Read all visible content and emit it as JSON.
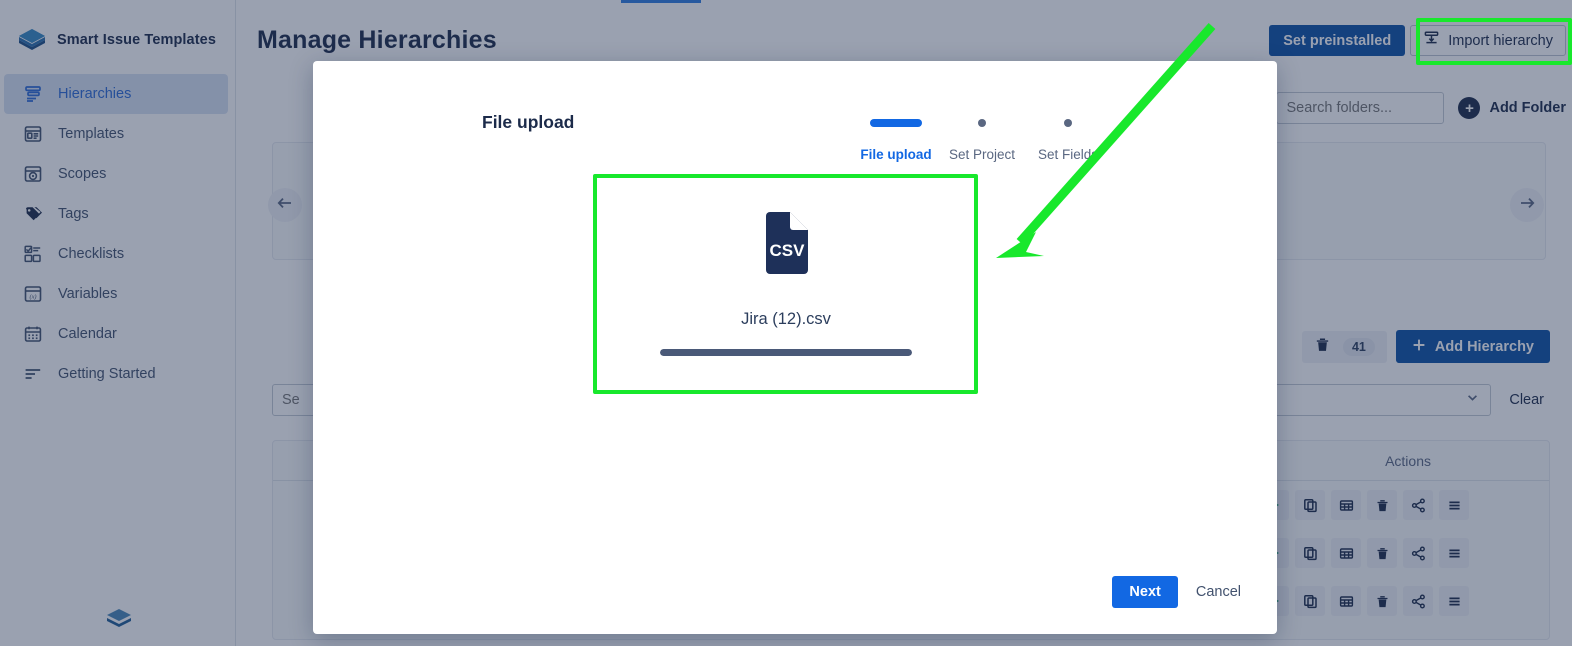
{
  "colors": {
    "brand_blue": "#0c50a4",
    "accent_blue": "#1268e3",
    "navy": "#1c2b4a",
    "annotation_green": "#18e82c",
    "play_green": "#1f9e6e",
    "progress_fill": "#4a5978"
  },
  "sidebar": {
    "brand": "Smart Issue Templates",
    "brand_logo_icon": "layers-stack-icon",
    "footer_logo_icon": "layers-stack-icon",
    "items": [
      {
        "label": "Hierarchies",
        "icon": "hierarchy-icon",
        "active": true
      },
      {
        "label": "Templates",
        "icon": "template-window-icon",
        "active": false
      },
      {
        "label": "Scopes",
        "icon": "scope-target-icon",
        "active": false
      },
      {
        "label": "Tags",
        "icon": "tag-icon",
        "active": false
      },
      {
        "label": "Checklists",
        "icon": "checklist-icon",
        "active": false
      },
      {
        "label": "Variables",
        "icon": "variable-x-icon",
        "active": false
      },
      {
        "label": "Calendar",
        "icon": "calendar-icon",
        "active": false
      },
      {
        "label": "Getting Started",
        "icon": "lines-list-icon",
        "active": false
      }
    ]
  },
  "main": {
    "page_title": "Manage Hierarchies",
    "top_actions": {
      "set_preinstalled_label": "Set preinstalled",
      "import_hierarchy_label": "Import hierarchy",
      "import_hierarchy_icon": "import-tray-icon"
    },
    "folder_row": {
      "search_placeholder": "Search folders...",
      "search_value": "",
      "add_folder_label": "Add Folder",
      "add_folder_icon": "circle-plus-icon"
    },
    "carousel": {
      "prev_icon": "arrow-left-icon",
      "next_icon": "arrow-right-icon"
    },
    "toolbar": {
      "trash_icon": "trash-icon",
      "trash_count": "41",
      "add_hierarchy_label": "Add Hierarchy",
      "add_hierarchy_icon": "plus-icon"
    },
    "filters": {
      "search_placeholder": "Se",
      "search_value": "",
      "select_value": "",
      "select_icon": "chevron-down-icon",
      "clear_label": "Clear"
    },
    "table": {
      "columns": [
        "",
        "Actions"
      ],
      "row_action_icons": [
        "play-icon",
        "copy-icon",
        "table-icon",
        "trash-icon",
        "share-icon",
        "menu-icon"
      ],
      "row_count": 3
    }
  },
  "modal": {
    "title": "File upload",
    "steps": [
      {
        "label": "File upload",
        "active": true
      },
      {
        "label": "Set Project",
        "active": false
      },
      {
        "label": "Set Fields",
        "active": false
      }
    ],
    "dropzone": {
      "file_icon": "csv-file-icon",
      "file_name": "Jira (12).csv",
      "progress_percent": "100"
    },
    "footer": {
      "next_label": "Next",
      "cancel_label": "Cancel"
    }
  },
  "annotations": {
    "upload_box_highlight": "dropzone-highlight",
    "import_button_highlight": "import-hierarchy-highlight",
    "arrow": "pointer-arrow-to-dropzone"
  }
}
